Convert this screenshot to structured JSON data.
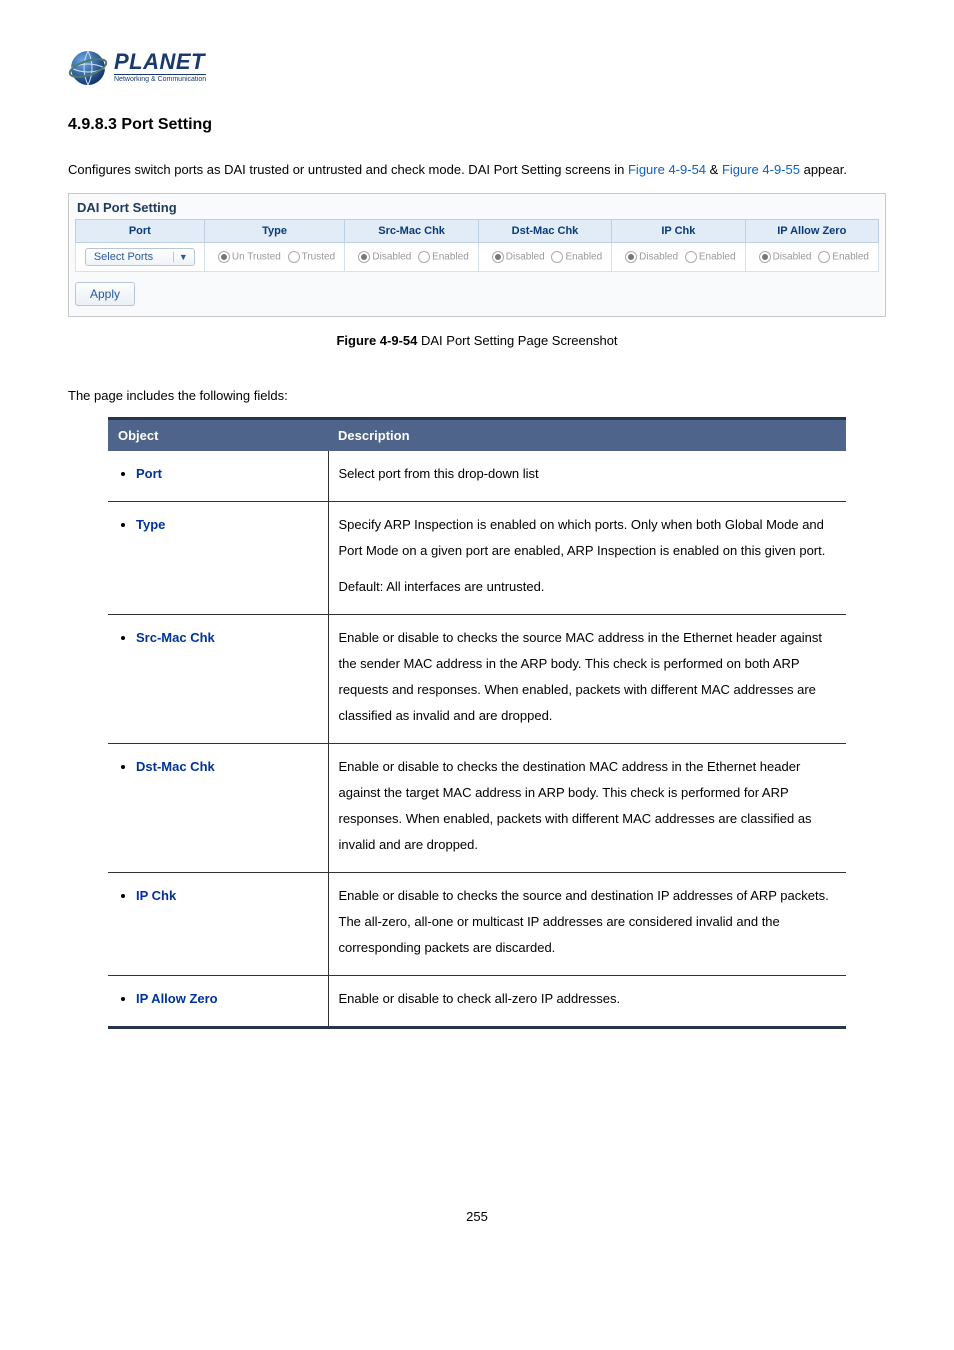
{
  "logo": {
    "word": "PLANET",
    "sub": "Networking & Communication"
  },
  "section_number": "4.9.8.3",
  "section_title": "Port Setting",
  "intro": {
    "pre": "Configures switch ports as DAI trusted or untrusted and check mode. DAI Port Setting screens in ",
    "ref1": "Figure 4-9-54",
    "amp": " & ",
    "ref2": "Figure 4-9-55",
    "post": " appear."
  },
  "dai": {
    "panel_title": "DAI Port Setting",
    "headers": [
      "Port",
      "Type",
      "Src-Mac Chk",
      "Dst-Mac Chk",
      "IP Chk",
      "IP Allow Zero"
    ],
    "select_label": "Select Ports",
    "type_opts": [
      "Un Trusted",
      "Trusted"
    ],
    "de_opts": [
      "Disabled",
      "Enabled"
    ],
    "apply": "Apply"
  },
  "figure": {
    "num": "Figure 4-9-54",
    "caption": " DAI Port Setting Page Screenshot"
  },
  "fields_intro": "The page includes the following fields:",
  "table": {
    "head_obj": "Object",
    "head_desc": "Description",
    "rows": [
      {
        "obj": "Port",
        "desc": "Select port from this drop-down list"
      },
      {
        "obj": "Type",
        "desc": "Specify ARP Inspection is enabled on which ports. Only when both Global Mode and Port Mode on a given port are enabled, ARP Inspection is enabled on this given port.",
        "extra": "Default: All interfaces are untrusted."
      },
      {
        "obj": "Src-Mac Chk",
        "desc": "Enable or disable to checks the source MAC address in the Ethernet header against the sender MAC address in the ARP body. This check is performed on both ARP requests and responses. When enabled, packets with different MAC addresses are classified as invalid and are dropped."
      },
      {
        "obj": "Dst-Mac Chk",
        "desc": "Enable or disable to checks the destination MAC address in the Ethernet header against the target MAC address in ARP body. This check is performed for ARP responses. When enabled, packets with different MAC addresses are classified as invalid and are dropped."
      },
      {
        "obj": "IP Chk",
        "desc": "Enable or disable to checks the source and destination IP addresses of ARP packets. The all-zero, all-one or multicast IP addresses are considered invalid and the corresponding packets are discarded."
      },
      {
        "obj": "IP Allow Zero",
        "desc": "Enable or disable to check all-zero IP addresses."
      }
    ]
  },
  "page_number": "255"
}
